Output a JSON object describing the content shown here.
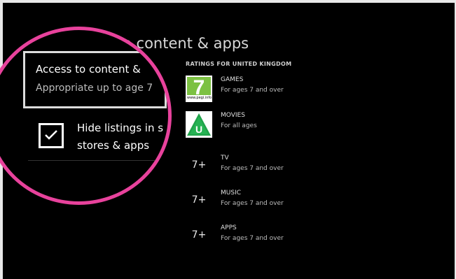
{
  "page": {
    "title": "o content & apps"
  },
  "ratings": {
    "header": "RATINGS FOR UNITED KINGDOM",
    "items": [
      {
        "name": "GAMES",
        "desc": "For ages 7 and over",
        "icon": "pegi-7-icon",
        "icon_label": "7",
        "icon_footer": "www.pegi.info"
      },
      {
        "name": "MOVIES",
        "desc": "For all ages",
        "icon": "bbfc-u-icon",
        "icon_label": "U"
      },
      {
        "name": "TV",
        "desc": "For ages 7 and over",
        "icon_label": "7+"
      },
      {
        "name": "MUSIC",
        "desc": "For ages 7 and over",
        "icon_label": "7+"
      },
      {
        "name": "APPS",
        "desc": "For ages 7 and over",
        "icon_label": "7+"
      }
    ]
  },
  "magnifier": {
    "access_title": "Access to content &",
    "access_sub": "Appropriate up to age 7",
    "hide_label": "Hide listings in s stores & apps",
    "hide_checked": true
  },
  "colors": {
    "magnifier_ring": "#e8429c",
    "pegi_green": "#7cc142",
    "bbfc_green": "#1fa34a"
  }
}
